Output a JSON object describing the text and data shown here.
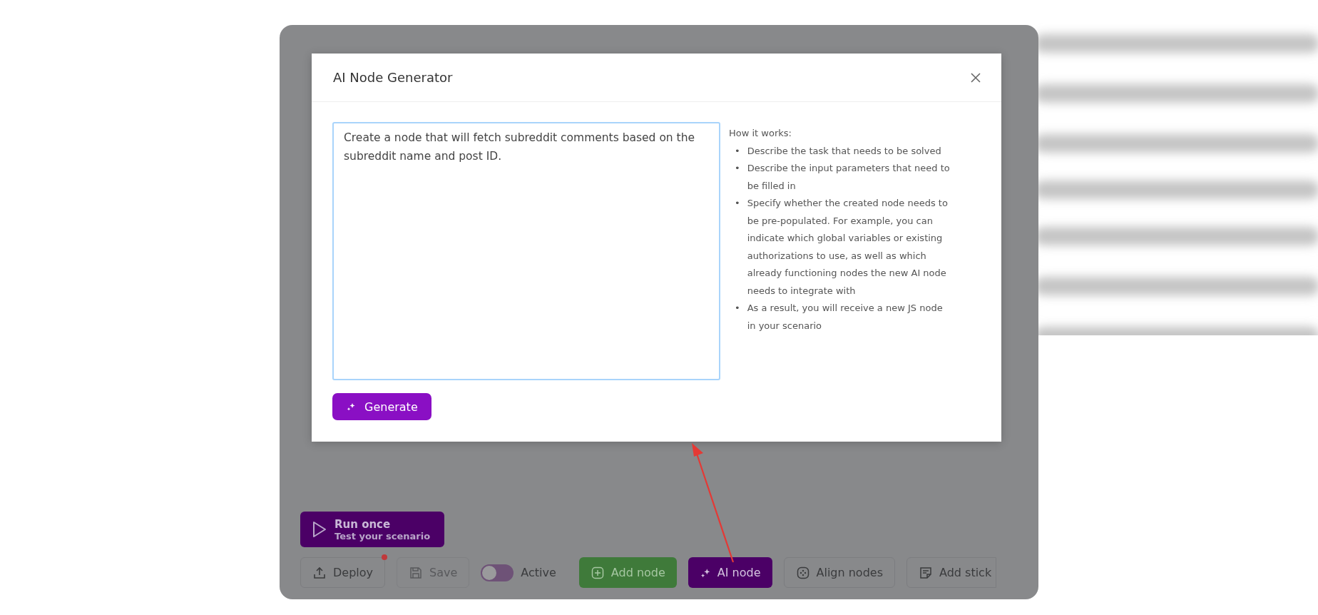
{
  "dialog": {
    "title": "AI Node Generator",
    "prompt": {
      "value": "Create a node that will fetch subreddit comments based on the subreddit name and post ID."
    },
    "generate_button": "Generate",
    "help": {
      "heading": "How it works:",
      "items": [
        {
          "bullet": "•",
          "text": "Describe the task that needs to be solved"
        },
        {
          "bullet": "•",
          "text": "Describe the input parameters that need to be filled in"
        },
        {
          "bullet": "•",
          "text": "Specify whether the created node needs to be pre-populated. For example, you can indicate which global variables or existing authorizations to use, as well as which already functioning nodes the new AI node needs to integrate with"
        },
        {
          "bullet": "•",
          "text": "As a result, you will receive a new JS node in your scenario"
        }
      ]
    }
  },
  "run_once": {
    "title": "Run once",
    "subtitle": "Test your scenario"
  },
  "toolbar": [
    {
      "kind": "button",
      "label": "Deploy",
      "disabled": false,
      "badge": true
    },
    {
      "kind": "button",
      "label": "Save",
      "disabled": true,
      "badge": false
    },
    {
      "kind": "toggle",
      "label": "Active",
      "on": false
    },
    {
      "kind": "button",
      "label": "Add node",
      "disabled": false,
      "badge": false
    },
    {
      "kind": "button",
      "label": "AI node",
      "disabled": false,
      "badge": false
    },
    {
      "kind": "button",
      "label": "Align nodes",
      "disabled": false,
      "badge": false
    },
    {
      "kind": "button",
      "label": "Add stick",
      "disabled": false,
      "badge": false
    }
  ]
}
